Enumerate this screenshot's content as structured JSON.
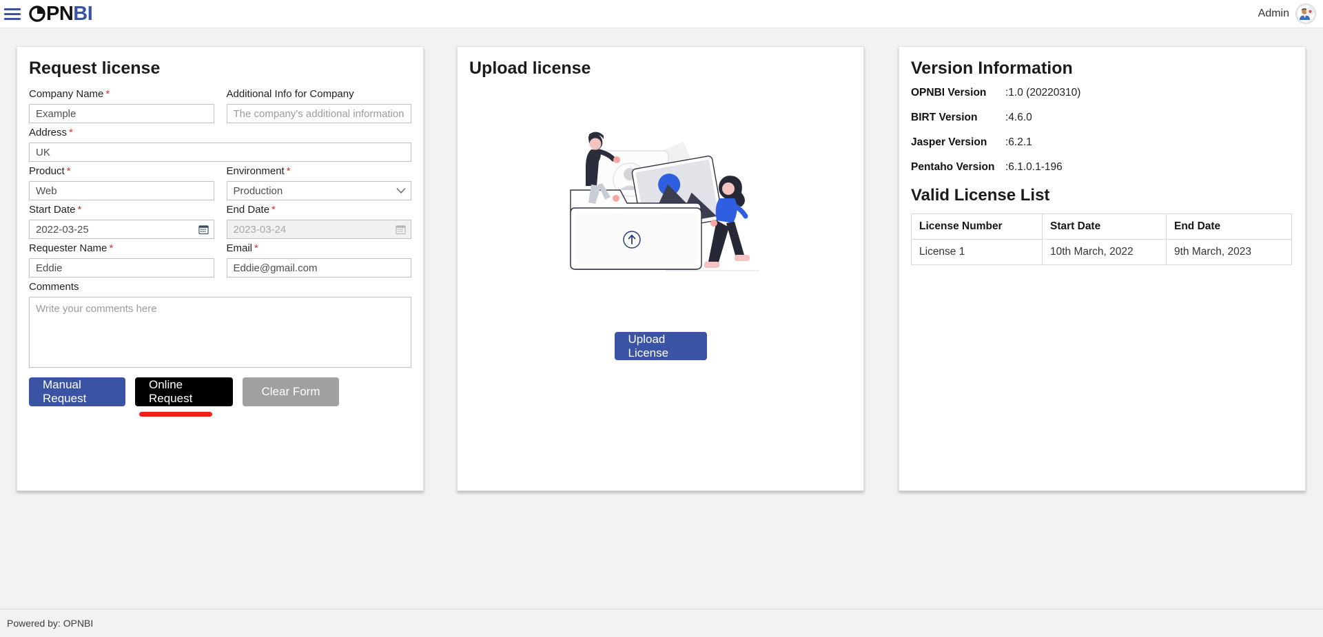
{
  "header": {
    "menu_icon": "hamburger-icon",
    "brand_dark": "PN",
    "brand_accent": "BI",
    "brand_full": "OPNBI",
    "admin_label": "Admin",
    "avatar_icon": "user-avatar-icon"
  },
  "request_card": {
    "title": "Request license",
    "fields": {
      "company_name": {
        "label": "Company Name",
        "required": "*",
        "value": "Example"
      },
      "additional_info": {
        "label": "Additional Info for Company",
        "required": "",
        "placeholder": "The company's additional information",
        "value": ""
      },
      "address": {
        "label": "Address",
        "required": "*",
        "value": "UK"
      },
      "product": {
        "label": "Product",
        "required": "*",
        "value": "Web"
      },
      "environment": {
        "label": "Environment",
        "required": "*",
        "value": "Production",
        "options": [
          "Production"
        ]
      },
      "start_date": {
        "label": "Start Date",
        "required": "*",
        "value": "2022-03-25"
      },
      "end_date": {
        "label": "End Date",
        "required": "*",
        "value": "2023-03-24"
      },
      "requester_name": {
        "label": "Requester Name",
        "required": "*",
        "value": "Eddie"
      },
      "email": {
        "label": "Email",
        "required": "*",
        "value": "Eddie@gmail.com"
      },
      "comments": {
        "label": "Comments",
        "required": "",
        "placeholder": "Write your comments here",
        "value": ""
      }
    },
    "buttons": {
      "manual_request": "Manual Request",
      "online_request": "Online Request",
      "clear_form": "Clear Form"
    },
    "annotation_color": "#f01f1f"
  },
  "upload_card": {
    "title": "Upload license",
    "illustration": "file-upload-illustration",
    "upload_button": "Upload License"
  },
  "version_card": {
    "title": "Version Information",
    "rows": [
      {
        "key": "OPNBI Version",
        "value": ":1.0 (20220310)"
      },
      {
        "key": "BIRT Version",
        "value": ":4.6.0"
      },
      {
        "key": "Jasper Version",
        "value": ":6.2.1"
      },
      {
        "key": "Pentaho Version",
        "value": ":6.1.0.1-196"
      }
    ],
    "license_list": {
      "title": "Valid License List",
      "columns": [
        "License Number",
        "Start Date",
        "End Date"
      ],
      "rows": [
        [
          "License 1",
          "10th March, 2022",
          "9th March, 2023"
        ]
      ]
    }
  },
  "footer": {
    "text": "Powered by: OPNBI"
  },
  "colors": {
    "accent_blue": "#3a53a4",
    "dark_button": "#000000",
    "muted_button": "#a0a0a0",
    "required_red": "#e03131",
    "annotation_red": "#f01f1f"
  }
}
